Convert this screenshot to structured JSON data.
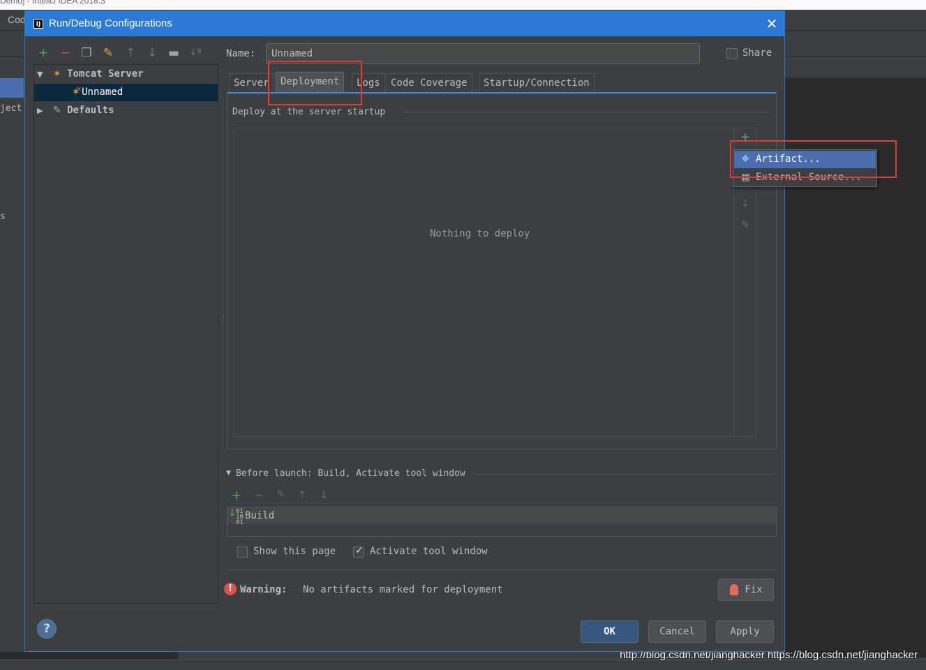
{
  "ide": {
    "window_title": "Demo] - IntelliJ IDEA 2018.3",
    "menu_code": "Code",
    "left_text": "ject",
    "left_s": "s",
    "watermark": "http://blog.csdn.net/jianghacker https://blog.csdn.net/jianghacker"
  },
  "dialog": {
    "title": "Run/Debug Configurations",
    "title_icon": "IJ",
    "close": "✕"
  },
  "toolbar_icons": [
    "add-icon",
    "remove-icon",
    "copy-icon",
    "wrench-icon",
    "move-up-icon",
    "move-down-icon",
    "folder-icon",
    "sort-icon"
  ],
  "tree": {
    "items": [
      {
        "label": "Tomcat Server",
        "expanded": true,
        "bold": true,
        "icon": "tomcat-icon"
      },
      {
        "label": "Unnamed",
        "selected": true,
        "icon": "tomcat-error-icon"
      },
      {
        "label": "Defaults",
        "expanded": false,
        "bold": true,
        "icon": "wrench-icon"
      }
    ]
  },
  "form": {
    "name_label": "Name:",
    "name_value": "Unnamed",
    "share_label": "Share",
    "share_checked": false
  },
  "tabs": [
    {
      "label": "Server",
      "active": false
    },
    {
      "label": "Deployment",
      "active": true
    },
    {
      "label": "Logs",
      "active": false
    },
    {
      "label": "Code Coverage",
      "active": false
    },
    {
      "label": "Startup/Connection",
      "active": false
    }
  ],
  "deployment": {
    "legend": "Deploy at the server startup",
    "empty_text": "Nothing to deploy",
    "side_icons": [
      "add-icon",
      "move-down-icon",
      "edit-icon"
    ]
  },
  "popup": {
    "items": [
      {
        "label": "Artifact...",
        "selected": true,
        "icon": "artifact-icon"
      },
      {
        "label": "External Source...",
        "selected": false,
        "icon": "external-source-icon"
      }
    ]
  },
  "before_launch": {
    "label": "Before launch: Build, Activate tool window",
    "icons": [
      "add-icon",
      "remove-icon",
      "edit-icon",
      "move-up-icon",
      "move-down-icon"
    ],
    "items": [
      "Build"
    ]
  },
  "options": {
    "show_page_label": "Show this page",
    "show_page_checked": false,
    "activate_label": "Activate tool window",
    "activate_checked": true
  },
  "warning": {
    "strong": "Warning:",
    "text": "No artifacts marked for deployment",
    "fix_label": "Fix"
  },
  "buttons": {
    "ok": "OK",
    "cancel": "Cancel",
    "apply": "Apply",
    "help": "?"
  },
  "colors": {
    "accent": "#2a7ad6",
    "highlight": "#e53935",
    "selection": "#4b6eaf"
  }
}
